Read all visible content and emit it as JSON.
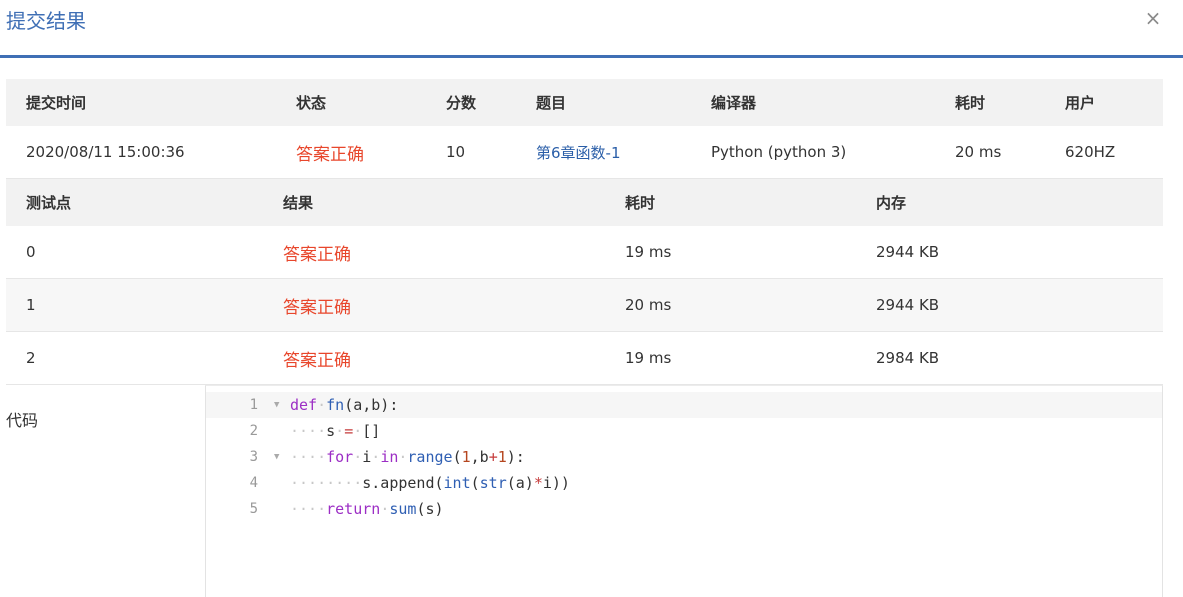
{
  "dialog": {
    "title": "提交结果",
    "close_symbol": "×"
  },
  "submission": {
    "headers": [
      "提交时间",
      "状态",
      "分数",
      "题目",
      "编译器",
      "耗时",
      "用户"
    ],
    "row": {
      "time": "2020/08/11 15:00:36",
      "status": "答案正确",
      "score": "10",
      "problem": "第6章函数-1",
      "compiler": "Python (python 3)",
      "duration": "20 ms",
      "user": "620HZ"
    }
  },
  "testcases": {
    "headers": [
      "测试点",
      "结果",
      "耗时",
      "内存"
    ],
    "rows": [
      {
        "id": "0",
        "result": "答案正确",
        "time": "19 ms",
        "memory": "2944 KB"
      },
      {
        "id": "1",
        "result": "答案正确",
        "time": "20 ms",
        "memory": "2944 KB"
      },
      {
        "id": "2",
        "result": "答案正确",
        "time": "19 ms",
        "memory": "2984 KB"
      }
    ]
  },
  "code": {
    "label": "代码",
    "line_numbers": [
      "1",
      "2",
      "3",
      "4",
      "5"
    ],
    "lines": [
      "def·fn(a,b):",
      "····s·=·[]",
      "····for·i·in·range(1,b+1):",
      "········s.append(int(str(a)*i))",
      "····return·sum(s)"
    ]
  },
  "colors": {
    "accent": "#3f6fb5",
    "status_ok": "#e8462b",
    "link": "#2a5ea8",
    "header_bg": "#f2f2f2"
  }
}
